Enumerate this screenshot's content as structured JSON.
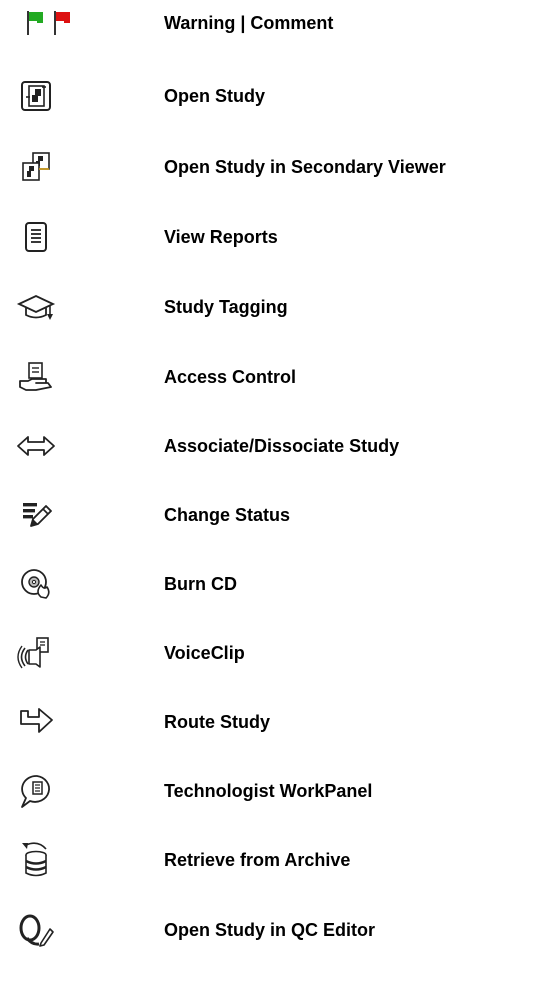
{
  "legend": {
    "items": [
      {
        "icon": "green-red-flag-icons",
        "label": "Warning | Comment",
        "colors": [
          "#22aa22",
          "#dd1111"
        ]
      },
      {
        "icon": "open-study-icon",
        "label": "Open Study"
      },
      {
        "icon": "open-study-secondary-viewer-icon",
        "label": "Open Study in Secondary Viewer"
      },
      {
        "icon": "view-reports-icon",
        "label": "View Reports"
      },
      {
        "icon": "study-tagging-icon",
        "label": "Study Tagging"
      },
      {
        "icon": "access-control-icon",
        "label": "Access Control"
      },
      {
        "icon": "associate-dissociate-icon",
        "label": "Associate/Dissociate Study"
      },
      {
        "icon": "change-status-icon",
        "label": "Change Status"
      },
      {
        "icon": "burn-cd-icon",
        "label": "Burn CD"
      },
      {
        "icon": "voiceclip-icon",
        "label": "VoiceClip"
      },
      {
        "icon": "route-study-icon",
        "label": "Route Study"
      },
      {
        "icon": "technologist-workpanel-icon",
        "label": "Technologist WorkPanel"
      },
      {
        "icon": "retrieve-archive-icon",
        "label": "Retrieve from Archive"
      },
      {
        "icon": "qc-editor-icon",
        "label": "Open Study in QC Editor"
      }
    ]
  }
}
